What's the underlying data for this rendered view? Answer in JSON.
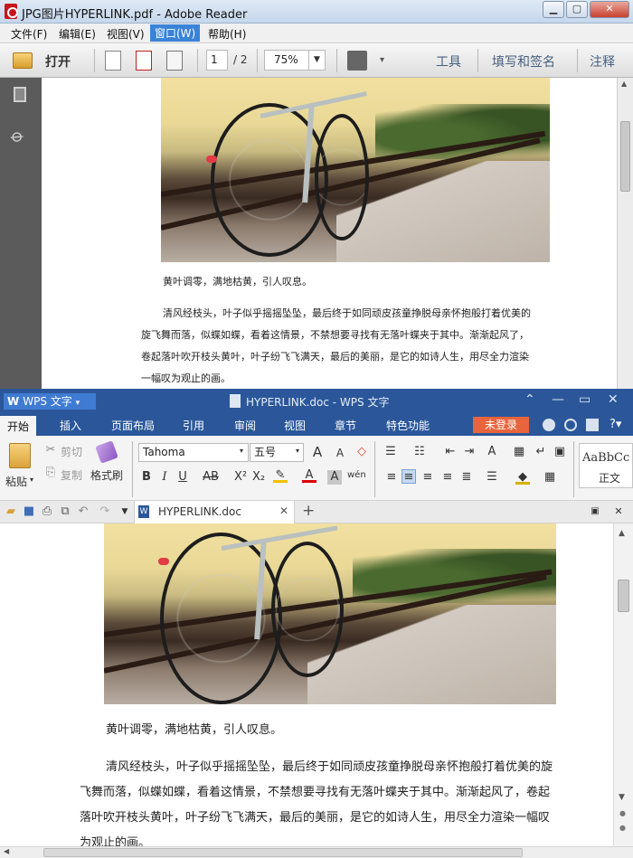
{
  "reader": {
    "title": "JPG图片HYPERLINK.pdf - Adobe Reader",
    "menu": [
      "文件(F)",
      "编辑(E)",
      "视图(V)",
      "窗口(W)",
      "帮助(H)"
    ],
    "active_menu_index": 3,
    "open_label": "打开",
    "page_current": "1",
    "page_total": "/ 2",
    "zoom": "75%",
    "right_tools": [
      "工具",
      "填写和签名",
      "注释"
    ],
    "caption": "黄叶调零，满地枯黄，引人叹息。",
    "paragraph_lines": [
      "清风经枝头，叶子似乎摇摇坠坠，最后终于如同顽皮孩童挣脱母亲怀抱般打着优美的",
      "旋飞舞而落，似蝶如蝶，看着这情景，不禁想要寻找有无落叶蝶夹于其中。渐渐起风了，",
      "卷起落叶吹开枝头黄叶，叶子纷飞飞满天，最后的美丽，是它的如诗人生，用尽全力渲染",
      "一幅叹为观止的画。"
    ]
  },
  "wps": {
    "app_label": "WPS 文字",
    "doc_title": "HYPERLINK.doc - WPS 文字",
    "tabs": [
      "开始",
      "插入",
      "页面布局",
      "引用",
      "审阅",
      "视图",
      "章节",
      "特色功能"
    ],
    "login_label": "未登录",
    "paste_label": "粘贴",
    "cut_label": "剪切",
    "copy_label": "复制",
    "format_painter_label": "格式刷",
    "font_name": "Tahoma",
    "font_size": "五号",
    "style_preview": "AaBbCc",
    "style_name": "正文",
    "doc_tab_name": "HYPERLINK.doc",
    "caption": "黄叶调零，满地枯黄，引人叹息。",
    "paragraph_lines": [
      "清风经枝头，叶子似乎摇摇坠坠，最后终于如同顽皮孩童挣脱母亲怀抱般打着优美的旋",
      "飞舞而落，似蝶如蝶，看着这情景，不禁想要寻找有无落叶蝶夹于其中。渐渐起风了，卷起",
      "落叶吹开枝头黄叶，叶子纷飞飞满天，最后的美丽，是它的如诗人生，用尽全力渲染一幅叹",
      "为观止的画。"
    ]
  }
}
